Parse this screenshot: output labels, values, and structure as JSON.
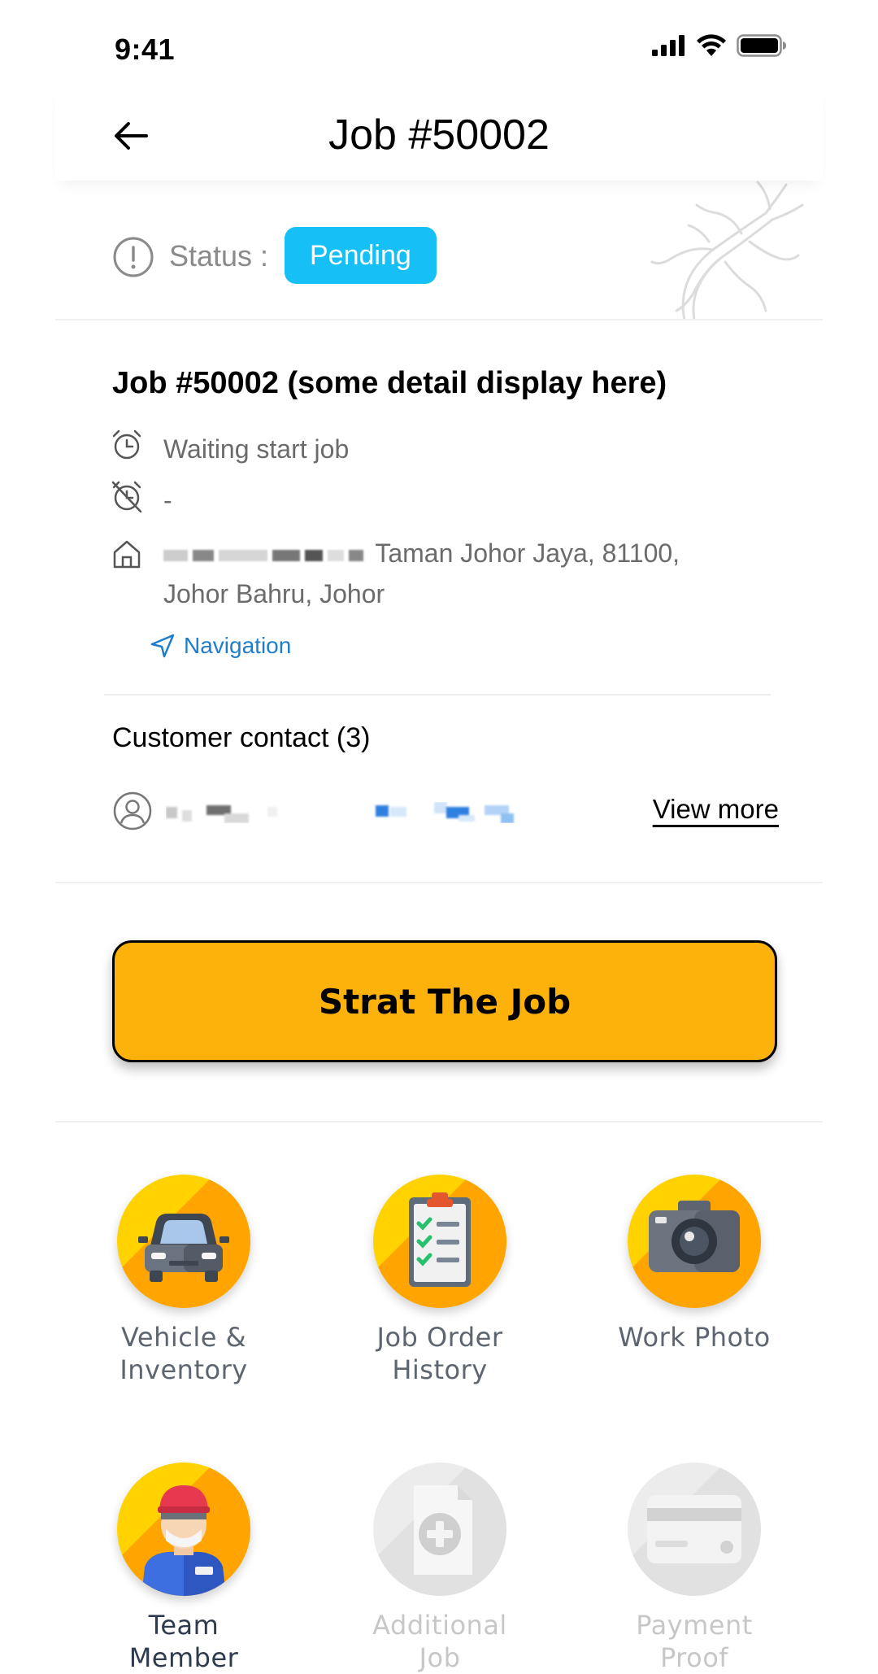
{
  "status_bar": {
    "time": "9:41"
  },
  "header": {
    "title": "Job #50002"
  },
  "status": {
    "label": "Status :",
    "value": "Pending",
    "badge_color": "#16c0f7"
  },
  "job": {
    "heading": "Job #50002 (some detail display here)",
    "start_time": "Waiting start job",
    "end_time": "-",
    "address_line1": "Taman Johor Jaya, 81100,",
    "address_line2": "Johor Bahru, Johor",
    "navigation_label": "Navigation"
  },
  "contact": {
    "title": "Customer contact (3)",
    "view_more_label": "View more"
  },
  "cta": {
    "label": "Strat The Job",
    "color": "#fdb10b"
  },
  "tiles": [
    {
      "line1": "Vehicle &",
      "line2": "Inventory",
      "icon": "car-icon",
      "enabled": true
    },
    {
      "line1": "Job Order",
      "line2": "History",
      "icon": "checklist-icon",
      "enabled": true
    },
    {
      "line1": "Work Photo",
      "line2": "",
      "icon": "camera-icon",
      "enabled": true
    },
    {
      "line1": "Team",
      "line2": "Member",
      "icon": "worker-icon",
      "enabled": true
    },
    {
      "line1": "Additional",
      "line2": "Job",
      "icon": "add-document-icon",
      "enabled": false
    },
    {
      "line1": "Payment",
      "line2": "Proof",
      "icon": "credit-card-icon",
      "enabled": false
    }
  ],
  "colors": {
    "accent_yellow": "#fdb10b",
    "link_blue": "#1e7ecb",
    "tile_yellow": "#ffd200",
    "tile_orange": "#ffa400"
  }
}
